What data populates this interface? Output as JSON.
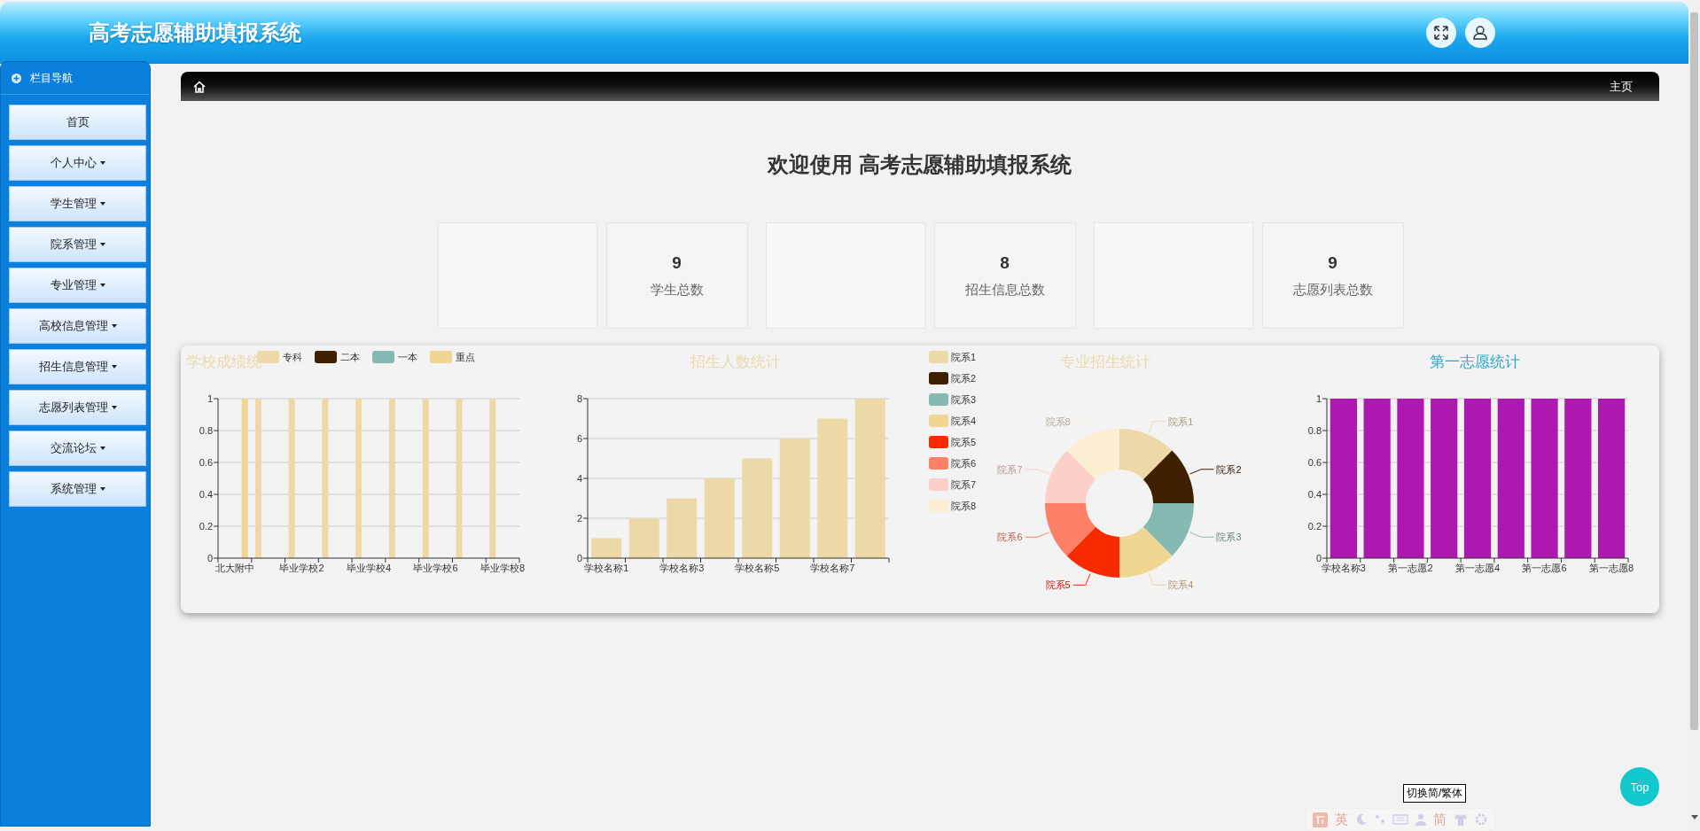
{
  "header": {
    "title": "高考志愿辅助填报系统"
  },
  "sidebar": {
    "title": "栏目导航",
    "items": [
      {
        "label": "首页",
        "kind": "link"
      },
      {
        "label": "个人中心",
        "kind": "menu"
      },
      {
        "label": "学生管理",
        "kind": "menu"
      },
      {
        "label": "院系管理",
        "kind": "menu"
      },
      {
        "label": "专业管理",
        "kind": "menu"
      },
      {
        "label": "高校信息管理",
        "kind": "menu"
      },
      {
        "label": "招生信息管理",
        "kind": "menu"
      },
      {
        "label": "志愿列表管理",
        "kind": "menu"
      },
      {
        "label": "交流论坛",
        "kind": "menu"
      },
      {
        "label": "系统管理",
        "kind": "menu"
      }
    ]
  },
  "breadcrumb": {
    "label": "主页"
  },
  "welcome": "欢迎使用 高考志愿辅助填报系统",
  "stats": [
    {
      "value": "9",
      "label": "学生总数"
    },
    {
      "value": "8",
      "label": "招生信息总数"
    },
    {
      "value": "9",
      "label": "志愿列表总数"
    }
  ],
  "charts": [
    {
      "chart_data": {
        "type": "bar",
        "title": "学校成绩统",
        "grid": true,
        "legend": true,
        "categories": [
          "北大附中",
          null,
          "毕业学校2",
          null,
          "毕业学校4",
          null,
          "毕业学校6",
          null,
          "毕业学校8"
        ],
        "ylim": [
          0,
          1
        ],
        "yticks": [
          0,
          0.2,
          0.4,
          0.6,
          0.8,
          1
        ],
        "series": [
          {
            "name": "专科",
            "color": "#edd8a8",
            "values": [
              0,
              1,
              1,
              1,
              1,
              1,
              1,
              1,
              1
            ]
          },
          {
            "name": "二本",
            "color": "#3e1f00",
            "values": [
              0,
              0,
              0,
              0,
              0,
              0,
              0,
              0,
              0
            ]
          },
          {
            "name": "一本",
            "color": "#86b9b1",
            "values": [
              0,
              0,
              0,
              0,
              0,
              0,
              0,
              0,
              0
            ]
          },
          {
            "name": "重点",
            "color": "#f0d593",
            "values": [
              1,
              0,
              0,
              0,
              0,
              0,
              0,
              0,
              0
            ]
          }
        ]
      }
    },
    {
      "chart_data": {
        "type": "bar",
        "title": "招生人数统计",
        "grid": true,
        "categories": [
          "学校名称1",
          null,
          "学校名称3",
          null,
          "学校名称5",
          null,
          "学校名称7",
          null
        ],
        "ylim": [
          0,
          8
        ],
        "yticks": [
          0,
          2,
          4,
          6,
          8
        ],
        "series": [
          {
            "color": "#edd8a8",
            "values": [
              1,
              2,
              3,
              4,
              5,
              6,
              7,
              8
            ]
          }
        ]
      }
    },
    {
      "chart_data": {
        "type": "donut",
        "title": "专业招生统计",
        "categories": [
          "院系1",
          "院系2",
          "院系3",
          "院系4",
          "院系5",
          "院系6",
          "院系7",
          "院系8"
        ],
        "values": [
          1,
          1,
          1,
          1,
          1,
          1,
          1,
          1
        ],
        "legend": true,
        "annotations": [
          {
            "text": "院系1"
          },
          {
            "text": "院系2"
          },
          {
            "text": "院系3"
          },
          {
            "text": "院系4"
          },
          {
            "text": "院系5"
          },
          {
            "text": "院系6"
          },
          {
            "text": "院系7"
          },
          {
            "text": "院系8"
          }
        ],
        "colors": [
          "#edd8a8",
          "#3e1f00",
          "#86b9b1",
          "#f0d593",
          "#f72a00",
          "#fe8066",
          "#fdcfc9",
          "#fbeed3"
        ]
      }
    },
    {
      "chart_data": {
        "type": "bar",
        "title": "第一志愿统计",
        "grid": true,
        "categories": [
          "学校名称3",
          null,
          "第一志愿2",
          null,
          "第一志愿4",
          null,
          "第一志愿6",
          null,
          "第一志愿8"
        ],
        "ylim": [
          0,
          1
        ],
        "yticks": [
          0,
          0.2,
          0.4,
          0.6,
          0.8,
          1
        ],
        "series": [
          {
            "color": "#ad18b0",
            "values": [
              1,
              1,
              1,
              1,
              1,
              1,
              1,
              1,
              1
            ]
          }
        ]
      }
    }
  ],
  "language_toggle": "切换简/繁体",
  "top_button": "Top",
  "ime_toolbar": {
    "texts": [
      "英",
      "简"
    ]
  }
}
